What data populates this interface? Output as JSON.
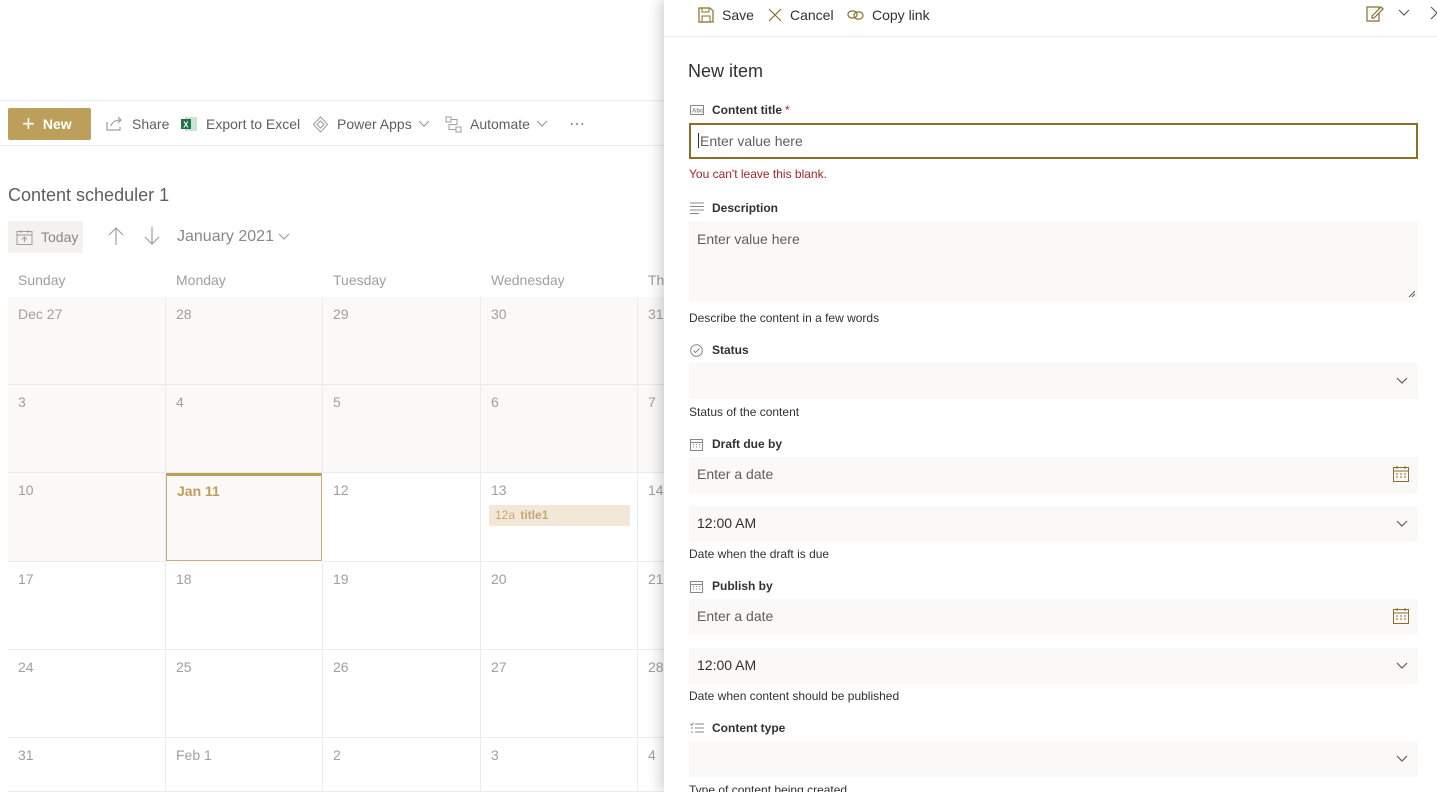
{
  "toolbar": {
    "new_label": "New",
    "share_label": "Share",
    "export_label": "Export to Excel",
    "powerapps_label": "Power Apps",
    "automate_label": "Automate",
    "more_label": "⋯"
  },
  "list": {
    "title": "Content scheduler 1",
    "today_label": "Today",
    "month_label": "January 2021"
  },
  "calendar": {
    "days_of_week": [
      "Sunday",
      "Monday",
      "Tuesday",
      "Wednesday",
      "Th"
    ],
    "weeks": [
      [
        "Dec 27",
        "28",
        "29",
        "30",
        "31"
      ],
      [
        "3",
        "4",
        "5",
        "6",
        "7"
      ],
      [
        "10",
        "Jan 11",
        "12",
        "13",
        "14"
      ],
      [
        "17",
        "18",
        "19",
        "20",
        "21"
      ],
      [
        "24",
        "25",
        "26",
        "27",
        "28"
      ],
      [
        "31",
        "Feb 1",
        "2",
        "3",
        "4"
      ]
    ],
    "event": {
      "time": "12a",
      "title": "title1"
    }
  },
  "panel": {
    "save_label": "Save",
    "cancel_label": "Cancel",
    "copy_link_label": "Copy link",
    "title": "New item",
    "fields": {
      "content_title": {
        "label": "Content title",
        "required_mark": "*",
        "placeholder": "Enter value here",
        "error": "You can't leave this blank."
      },
      "description": {
        "label": "Description",
        "placeholder": "Enter value here",
        "help": "Describe the content in a few words"
      },
      "status": {
        "label": "Status",
        "value": "",
        "help": "Status of the content"
      },
      "draft_due": {
        "label": "Draft due by",
        "date_placeholder": "Enter a date",
        "time": "12:00 AM",
        "help": "Date when the draft is due"
      },
      "publish_by": {
        "label": "Publish by",
        "date_placeholder": "Enter a date",
        "time": "12:00 AM",
        "help": "Date when content should be published"
      },
      "content_type": {
        "label": "Content type",
        "value": "",
        "help": "Type of content being created"
      }
    }
  },
  "colors": {
    "accent": "#bd9f5c",
    "accent_dark": "#8a6e2a",
    "error": "#a4262c",
    "event_bg": "#f3e8d8"
  }
}
